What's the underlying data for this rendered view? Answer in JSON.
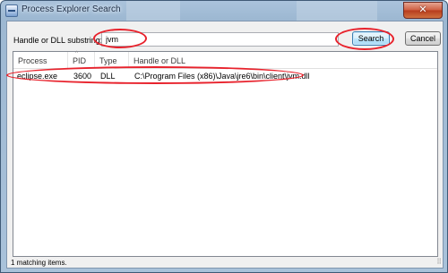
{
  "window": {
    "title": "Process Explorer Search",
    "close_glyph": "✕"
  },
  "search": {
    "label": "Handle or DLL substring:",
    "value": "jvm",
    "search_button": "Search",
    "cancel_button": "Cancel"
  },
  "results": {
    "columns": [
      "Process",
      "PID",
      "Type",
      "Handle or DLL"
    ],
    "sort_indicator": "^",
    "rows": [
      {
        "process": "eclipse.exe",
        "pid": "3600",
        "type": "DLL",
        "handle": "C:\\Program Files (x86)\\Java\\jre6\\bin\\client\\jvm.dll"
      }
    ]
  },
  "status": {
    "text": "1 matching items."
  },
  "annotations": {
    "highlight_color": "#e8222c"
  },
  "icons": {
    "app": "process-explorer-icon",
    "close": "close-icon",
    "grip": "resize-grip-icon"
  }
}
